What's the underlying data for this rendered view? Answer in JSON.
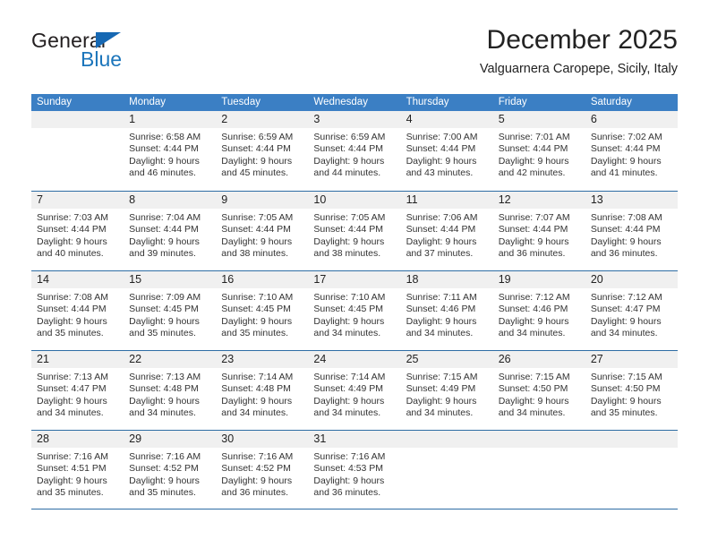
{
  "brand": {
    "name_part1": "General",
    "name_part2": "Blue",
    "triangle_icon": "triangle-icon",
    "accent_color": "#1b75bb"
  },
  "header": {
    "title": "December 2025",
    "subtitle": "Valguarnera Caropepe, Sicily, Italy"
  },
  "calendar": {
    "header_bg": "#3b7fc4",
    "weekdays": [
      "Sunday",
      "Monday",
      "Tuesday",
      "Wednesday",
      "Thursday",
      "Friday",
      "Saturday"
    ],
    "weeks": [
      [
        {
          "day": "",
          "lines": []
        },
        {
          "day": "1",
          "lines": [
            "Sunrise: 6:58 AM",
            "Sunset: 4:44 PM",
            "Daylight: 9 hours",
            "and 46 minutes."
          ]
        },
        {
          "day": "2",
          "lines": [
            "Sunrise: 6:59 AM",
            "Sunset: 4:44 PM",
            "Daylight: 9 hours",
            "and 45 minutes."
          ]
        },
        {
          "day": "3",
          "lines": [
            "Sunrise: 6:59 AM",
            "Sunset: 4:44 PM",
            "Daylight: 9 hours",
            "and 44 minutes."
          ]
        },
        {
          "day": "4",
          "lines": [
            "Sunrise: 7:00 AM",
            "Sunset: 4:44 PM",
            "Daylight: 9 hours",
            "and 43 minutes."
          ]
        },
        {
          "day": "5",
          "lines": [
            "Sunrise: 7:01 AM",
            "Sunset: 4:44 PM",
            "Daylight: 9 hours",
            "and 42 minutes."
          ]
        },
        {
          "day": "6",
          "lines": [
            "Sunrise: 7:02 AM",
            "Sunset: 4:44 PM",
            "Daylight: 9 hours",
            "and 41 minutes."
          ]
        }
      ],
      [
        {
          "day": "7",
          "lines": [
            "Sunrise: 7:03 AM",
            "Sunset: 4:44 PM",
            "Daylight: 9 hours",
            "and 40 minutes."
          ]
        },
        {
          "day": "8",
          "lines": [
            "Sunrise: 7:04 AM",
            "Sunset: 4:44 PM",
            "Daylight: 9 hours",
            "and 39 minutes."
          ]
        },
        {
          "day": "9",
          "lines": [
            "Sunrise: 7:05 AM",
            "Sunset: 4:44 PM",
            "Daylight: 9 hours",
            "and 38 minutes."
          ]
        },
        {
          "day": "10",
          "lines": [
            "Sunrise: 7:05 AM",
            "Sunset: 4:44 PM",
            "Daylight: 9 hours",
            "and 38 minutes."
          ]
        },
        {
          "day": "11",
          "lines": [
            "Sunrise: 7:06 AM",
            "Sunset: 4:44 PM",
            "Daylight: 9 hours",
            "and 37 minutes."
          ]
        },
        {
          "day": "12",
          "lines": [
            "Sunrise: 7:07 AM",
            "Sunset: 4:44 PM",
            "Daylight: 9 hours",
            "and 36 minutes."
          ]
        },
        {
          "day": "13",
          "lines": [
            "Sunrise: 7:08 AM",
            "Sunset: 4:44 PM",
            "Daylight: 9 hours",
            "and 36 minutes."
          ]
        }
      ],
      [
        {
          "day": "14",
          "lines": [
            "Sunrise: 7:08 AM",
            "Sunset: 4:44 PM",
            "Daylight: 9 hours",
            "and 35 minutes."
          ]
        },
        {
          "day": "15",
          "lines": [
            "Sunrise: 7:09 AM",
            "Sunset: 4:45 PM",
            "Daylight: 9 hours",
            "and 35 minutes."
          ]
        },
        {
          "day": "16",
          "lines": [
            "Sunrise: 7:10 AM",
            "Sunset: 4:45 PM",
            "Daylight: 9 hours",
            "and 35 minutes."
          ]
        },
        {
          "day": "17",
          "lines": [
            "Sunrise: 7:10 AM",
            "Sunset: 4:45 PM",
            "Daylight: 9 hours",
            "and 34 minutes."
          ]
        },
        {
          "day": "18",
          "lines": [
            "Sunrise: 7:11 AM",
            "Sunset: 4:46 PM",
            "Daylight: 9 hours",
            "and 34 minutes."
          ]
        },
        {
          "day": "19",
          "lines": [
            "Sunrise: 7:12 AM",
            "Sunset: 4:46 PM",
            "Daylight: 9 hours",
            "and 34 minutes."
          ]
        },
        {
          "day": "20",
          "lines": [
            "Sunrise: 7:12 AM",
            "Sunset: 4:47 PM",
            "Daylight: 9 hours",
            "and 34 minutes."
          ]
        }
      ],
      [
        {
          "day": "21",
          "lines": [
            "Sunrise: 7:13 AM",
            "Sunset: 4:47 PM",
            "Daylight: 9 hours",
            "and 34 minutes."
          ]
        },
        {
          "day": "22",
          "lines": [
            "Sunrise: 7:13 AM",
            "Sunset: 4:48 PM",
            "Daylight: 9 hours",
            "and 34 minutes."
          ]
        },
        {
          "day": "23",
          "lines": [
            "Sunrise: 7:14 AM",
            "Sunset: 4:48 PM",
            "Daylight: 9 hours",
            "and 34 minutes."
          ]
        },
        {
          "day": "24",
          "lines": [
            "Sunrise: 7:14 AM",
            "Sunset: 4:49 PM",
            "Daylight: 9 hours",
            "and 34 minutes."
          ]
        },
        {
          "day": "25",
          "lines": [
            "Sunrise: 7:15 AM",
            "Sunset: 4:49 PM",
            "Daylight: 9 hours",
            "and 34 minutes."
          ]
        },
        {
          "day": "26",
          "lines": [
            "Sunrise: 7:15 AM",
            "Sunset: 4:50 PM",
            "Daylight: 9 hours",
            "and 34 minutes."
          ]
        },
        {
          "day": "27",
          "lines": [
            "Sunrise: 7:15 AM",
            "Sunset: 4:50 PM",
            "Daylight: 9 hours",
            "and 35 minutes."
          ]
        }
      ],
      [
        {
          "day": "28",
          "lines": [
            "Sunrise: 7:16 AM",
            "Sunset: 4:51 PM",
            "Daylight: 9 hours",
            "and 35 minutes."
          ]
        },
        {
          "day": "29",
          "lines": [
            "Sunrise: 7:16 AM",
            "Sunset: 4:52 PM",
            "Daylight: 9 hours",
            "and 35 minutes."
          ]
        },
        {
          "day": "30",
          "lines": [
            "Sunrise: 7:16 AM",
            "Sunset: 4:52 PM",
            "Daylight: 9 hours",
            "and 36 minutes."
          ]
        },
        {
          "day": "31",
          "lines": [
            "Sunrise: 7:16 AM",
            "Sunset: 4:53 PM",
            "Daylight: 9 hours",
            "and 36 minutes."
          ]
        },
        {
          "day": "",
          "lines": []
        },
        {
          "day": "",
          "lines": []
        },
        {
          "day": "",
          "lines": []
        }
      ]
    ]
  }
}
